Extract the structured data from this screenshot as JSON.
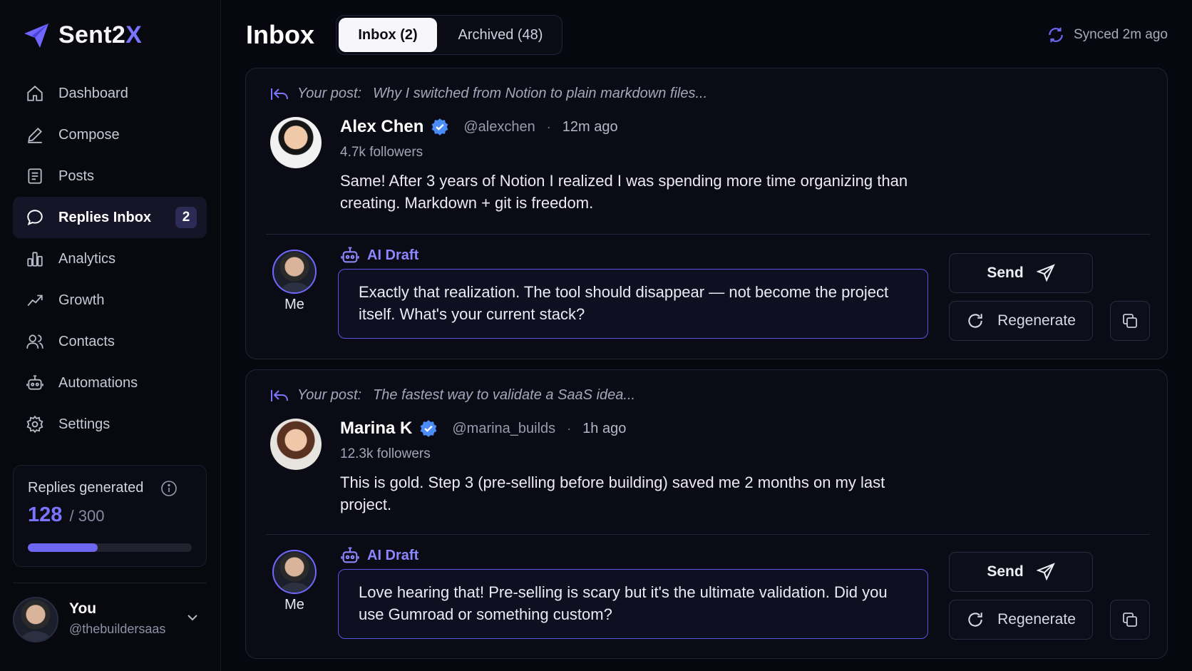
{
  "brand": {
    "name": "Sent2",
    "accent": "X"
  },
  "nav": {
    "items": [
      {
        "label": "Dashboard",
        "icon": "home-icon"
      },
      {
        "label": "Compose",
        "icon": "pen-icon"
      },
      {
        "label": "Posts",
        "icon": "document-icon"
      },
      {
        "label": "Replies Inbox",
        "icon": "chat-bubble-icon",
        "badge": "2",
        "active": true
      },
      {
        "label": "Analytics",
        "icon": "bar-chart-icon"
      },
      {
        "label": "Growth",
        "icon": "trend-up-icon"
      },
      {
        "label": "Contacts",
        "icon": "users-icon"
      },
      {
        "label": "Automations",
        "icon": "robot-icon"
      },
      {
        "label": "Settings",
        "icon": "gear-icon"
      }
    ]
  },
  "usage": {
    "label": "Replies generated",
    "used": "128",
    "total": "/ 300",
    "fraction": 0.427
  },
  "profile": {
    "name": "You",
    "handle": "@thebuildersaas"
  },
  "header": {
    "title": "Inbox",
    "tabs": [
      {
        "label": "Inbox (2)",
        "active": true
      },
      {
        "label": "Archived (48)",
        "active": false
      }
    ],
    "sync_status": "Synced 2m ago"
  },
  "replies": [
    {
      "post_label": "Your post:",
      "post_title": "Why I switched from Notion to plain markdown files...",
      "author": "Alex Chen",
      "handle": "@alexchen",
      "separator": "·",
      "time": "12m ago",
      "followers": "4.7k followers",
      "text": "Same! After 3 years of Notion I realized I was spending more time organizing than creating. Markdown + git is freedom.",
      "me_label": "Me",
      "ai_label": "AI Draft",
      "draft": "Exactly that realization. The tool should disappear — not become the project itself. What's your current stack?",
      "send_label": "Send",
      "regen_label": "Regenerate"
    },
    {
      "post_label": "Your post:",
      "post_title": "The fastest way to validate a SaaS idea...",
      "author": "Marina K",
      "handle": "@marina_builds",
      "separator": "·",
      "time": "1h ago",
      "followers": "12.3k followers",
      "text": "This is gold. Step 3 (pre-selling before building) saved me 2 months on my last project.",
      "me_label": "Me",
      "ai_label": "AI Draft",
      "draft": "Love hearing that! Pre-selling is scary but it's the ultimate validation. Did you use Gumroad or something custom?",
      "send_label": "Send",
      "regen_label": "Regenerate"
    }
  ],
  "colors": {
    "accent": "#7b74ff",
    "background": "#07070f",
    "card": "#0b0b15",
    "verified": "#4a8df8"
  }
}
